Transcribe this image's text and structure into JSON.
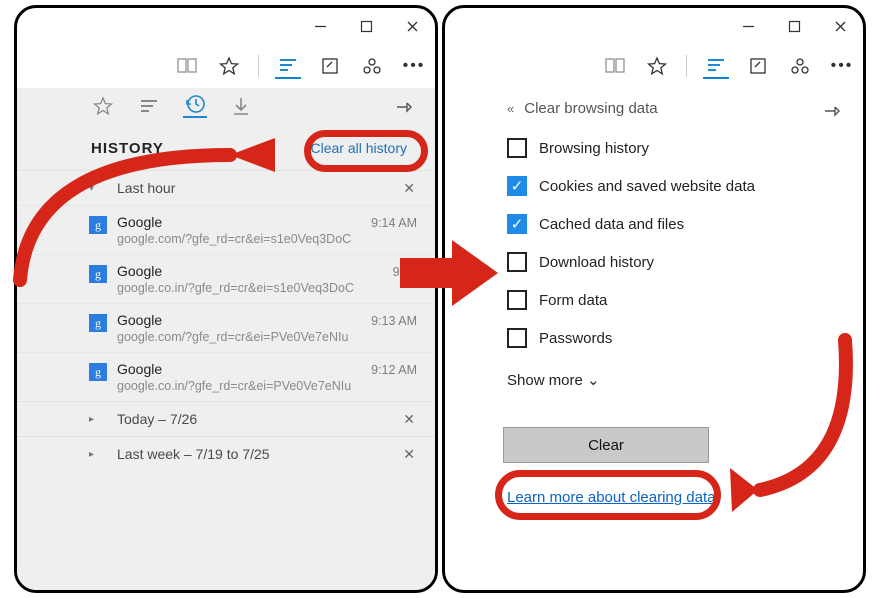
{
  "left": {
    "history_title": "HISTORY",
    "clear_all": "Clear all history",
    "sections": {
      "last_hour": "Last hour",
      "today": "Today – 7/26",
      "last_week": "Last week – 7/19 to 7/25"
    },
    "items": [
      {
        "title": "Google",
        "url": "google.com/?gfe_rd=cr&ei=s1e0Veq3DoC",
        "time": "9:14 AM"
      },
      {
        "title": "Google",
        "url": "google.co.in/?gfe_rd=cr&ei=s1e0Veq3DoC",
        "time": "9:14"
      },
      {
        "title": "Google",
        "url": "google.com/?gfe_rd=cr&ei=PVe0Ve7eNIu",
        "time": "9:13 AM"
      },
      {
        "title": "Google",
        "url": "google.co.in/?gfe_rd=cr&ei=PVe0Ve7eNIu",
        "time": "9:12 AM"
      }
    ]
  },
  "right": {
    "header": "Clear browsing data",
    "options": [
      {
        "label": "Browsing history",
        "checked": false
      },
      {
        "label": "Cookies and saved website data",
        "checked": true
      },
      {
        "label": "Cached data and files",
        "checked": true
      },
      {
        "label": "Download history",
        "checked": false
      },
      {
        "label": "Form data",
        "checked": false
      },
      {
        "label": "Passwords",
        "checked": false
      }
    ],
    "show_more": "Show more",
    "clear_btn": "Clear",
    "learn_more": "Learn more about clearing data"
  },
  "glyphs": {
    "g_favicon": "g",
    "x": "✕",
    "check": "✓",
    "chev_down": "⌄",
    "chev_back": "«",
    "disclose_down": "▾",
    "disclose_right": "▸"
  }
}
